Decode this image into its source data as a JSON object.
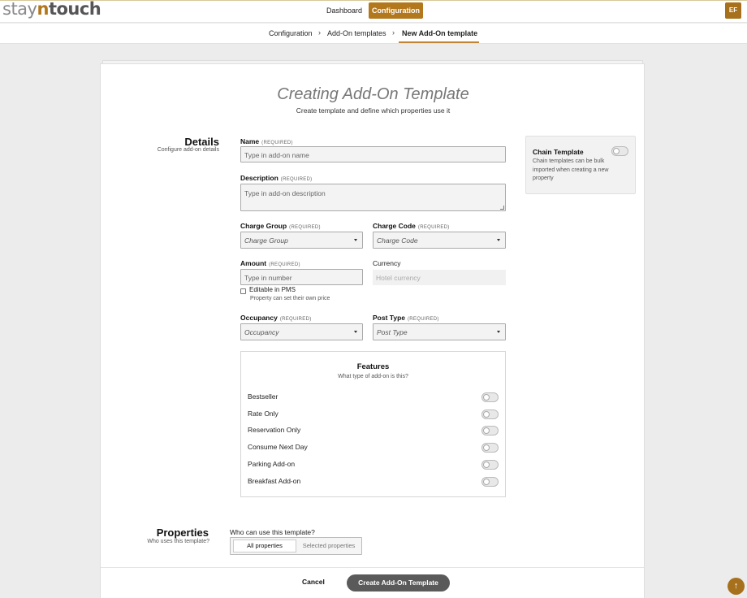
{
  "header": {
    "logo_part1": "stay",
    "logo_part2": "n",
    "logo_part3": "touch",
    "nav": {
      "dashboard": "Dashboard",
      "configuration": "Configuration"
    },
    "avatar": "EF"
  },
  "breadcrumb": {
    "items": [
      "Configuration",
      "Add-On templates",
      "New Add-On template"
    ],
    "separator": "›"
  },
  "page": {
    "title": "Creating Add-On Template",
    "subtitle": "Create template and define which properties use it"
  },
  "details": {
    "title": "Details",
    "subtitle": "Configure add-on details",
    "required_tag": "(REQUIRED)",
    "name": {
      "label": "Name",
      "placeholder": "Type in add-on name"
    },
    "description": {
      "label": "Description",
      "placeholder": "Type in add-on description"
    },
    "charge_group": {
      "label": "Charge Group",
      "value": "Charge Group"
    },
    "charge_code": {
      "label": "Charge Code",
      "value": "Charge Code"
    },
    "amount": {
      "label": "Amount",
      "placeholder": "Type in number"
    },
    "currency": {
      "label": "Currency",
      "value": "Hotel currency"
    },
    "editable": {
      "label": "Editable in PMS",
      "hint": "Property can set their own price"
    },
    "occupancy": {
      "label": "Occupancy",
      "value": "Occupancy"
    },
    "post_type": {
      "label": "Post Type",
      "value": "Post Type"
    }
  },
  "features": {
    "title": "Features",
    "subtitle": "What type of add-on is this?",
    "items": [
      {
        "label": "Bestseller",
        "on": false
      },
      {
        "label": "Rate Only",
        "on": false
      },
      {
        "label": "Reservation Only",
        "on": false
      },
      {
        "label": "Consume Next Day",
        "on": false
      },
      {
        "label": "Parking Add-on",
        "on": false
      },
      {
        "label": "Breakfast Add-on",
        "on": false
      }
    ]
  },
  "chain_template": {
    "title": "Chain Template",
    "description": "Chain templates can be bulk imported when creating a new property",
    "on": false
  },
  "properties": {
    "title": "Properties",
    "subtitle": "Who uses this template?",
    "question": "Who can use this template?",
    "options": [
      "All properties",
      "Selected properties"
    ],
    "selected": "All properties"
  },
  "footer": {
    "cancel": "Cancel",
    "create": "Create Add-On Template"
  },
  "fab": {
    "icon": "arrow-up-icon",
    "glyph": "↑"
  },
  "colors": {
    "accent": "#b3771c",
    "avatar": "#a6701d",
    "primary_button": "#5a5a5a"
  }
}
